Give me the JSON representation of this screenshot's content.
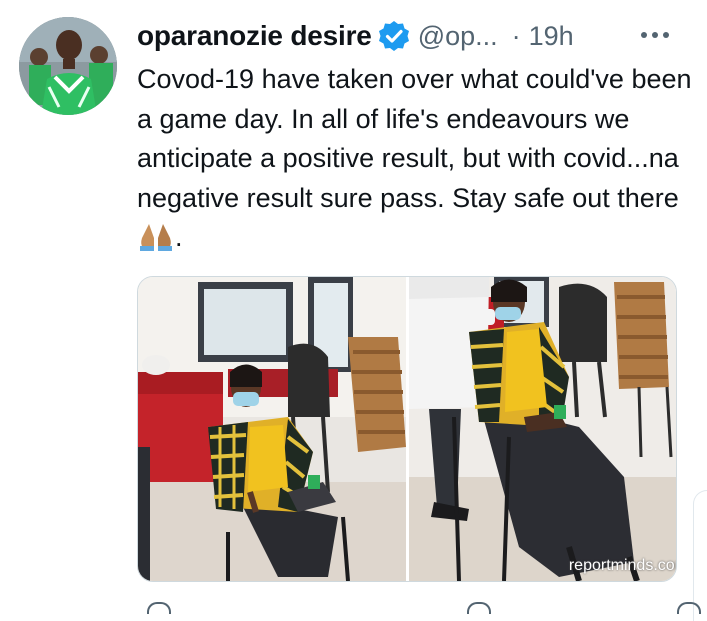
{
  "tweet": {
    "author_name": "oparanozie desire",
    "handle": "@op...",
    "separator": "·",
    "time": "19h",
    "text": "Covod-19 have taken over what could've been a game day. In all of life's endeavours we anticipate a positive result, but with covid...na negative result sure pass. Stay safe out there",
    "text_end": ".",
    "emoji": "folded-hands-emoji",
    "verified": true
  },
  "media": {
    "watermark": "reportminds.com"
  },
  "icons": {
    "verified": "verified-badge-icon",
    "more": "more-options-icon"
  },
  "colors": {
    "verified_blue": "#1d9bf0",
    "secondary_text": "#536471",
    "primary_text": "#0f1419",
    "border": "#cfd9de"
  }
}
